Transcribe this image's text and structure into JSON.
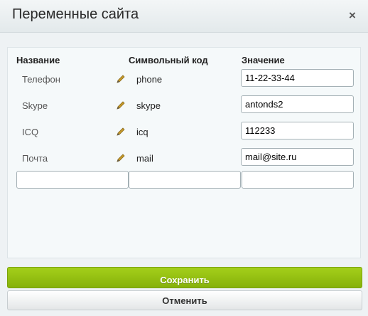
{
  "dialog": {
    "title": "Переменные сайта",
    "close_glyph": "×"
  },
  "table": {
    "headers": {
      "name": "Название",
      "code": "Символьный код",
      "value": "Значение"
    },
    "rows": [
      {
        "name": "Телефон",
        "code": "phone",
        "value": "11-22-33-44"
      },
      {
        "name": "Skype",
        "code": "skype",
        "value": "antonds2"
      },
      {
        "name": "ICQ",
        "code": "icq",
        "value": "112233"
      },
      {
        "name": "Почта",
        "code": "mail",
        "value": "mail@site.ru"
      }
    ],
    "new_row": {
      "name": "",
      "code": "",
      "value": ""
    }
  },
  "buttons": {
    "save": "Сохранить",
    "cancel": "Отменить"
  },
  "colors": {
    "save_accent": "#94c00f",
    "pencil": "#c79a2a"
  },
  "icons": {
    "edit": "pencil-icon",
    "close": "close-icon"
  }
}
